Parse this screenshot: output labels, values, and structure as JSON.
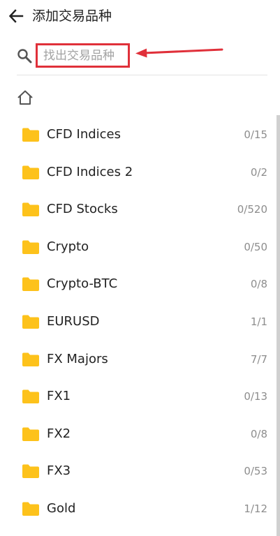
{
  "header": {
    "title": "添加交易品种",
    "back_icon": "arrow-left-icon"
  },
  "search": {
    "placeholder": "找出交易品种",
    "value": "",
    "icon": "search-icon",
    "highlight_color": "#e0303a"
  },
  "home": {
    "icon": "home-icon"
  },
  "folders": [
    {
      "name": "CFD Indices",
      "count": "0/15"
    },
    {
      "name": "CFD Indices 2",
      "count": "0/2"
    },
    {
      "name": "CFD Stocks",
      "count": "0/520"
    },
    {
      "name": "Crypto",
      "count": "0/50"
    },
    {
      "name": "Crypto-BTC",
      "count": "0/8"
    },
    {
      "name": "EURUSD",
      "count": "1/1"
    },
    {
      "name": "FX Majors",
      "count": "7/7"
    },
    {
      "name": "FX1",
      "count": "0/13"
    },
    {
      "name": "FX2",
      "count": "0/8"
    },
    {
      "name": "FX3",
      "count": "0/53"
    },
    {
      "name": "Gold",
      "count": "1/12"
    }
  ],
  "colors": {
    "folder": "#fdc21b",
    "annotation": "#e0303a",
    "count_text": "#8d8d8d"
  }
}
